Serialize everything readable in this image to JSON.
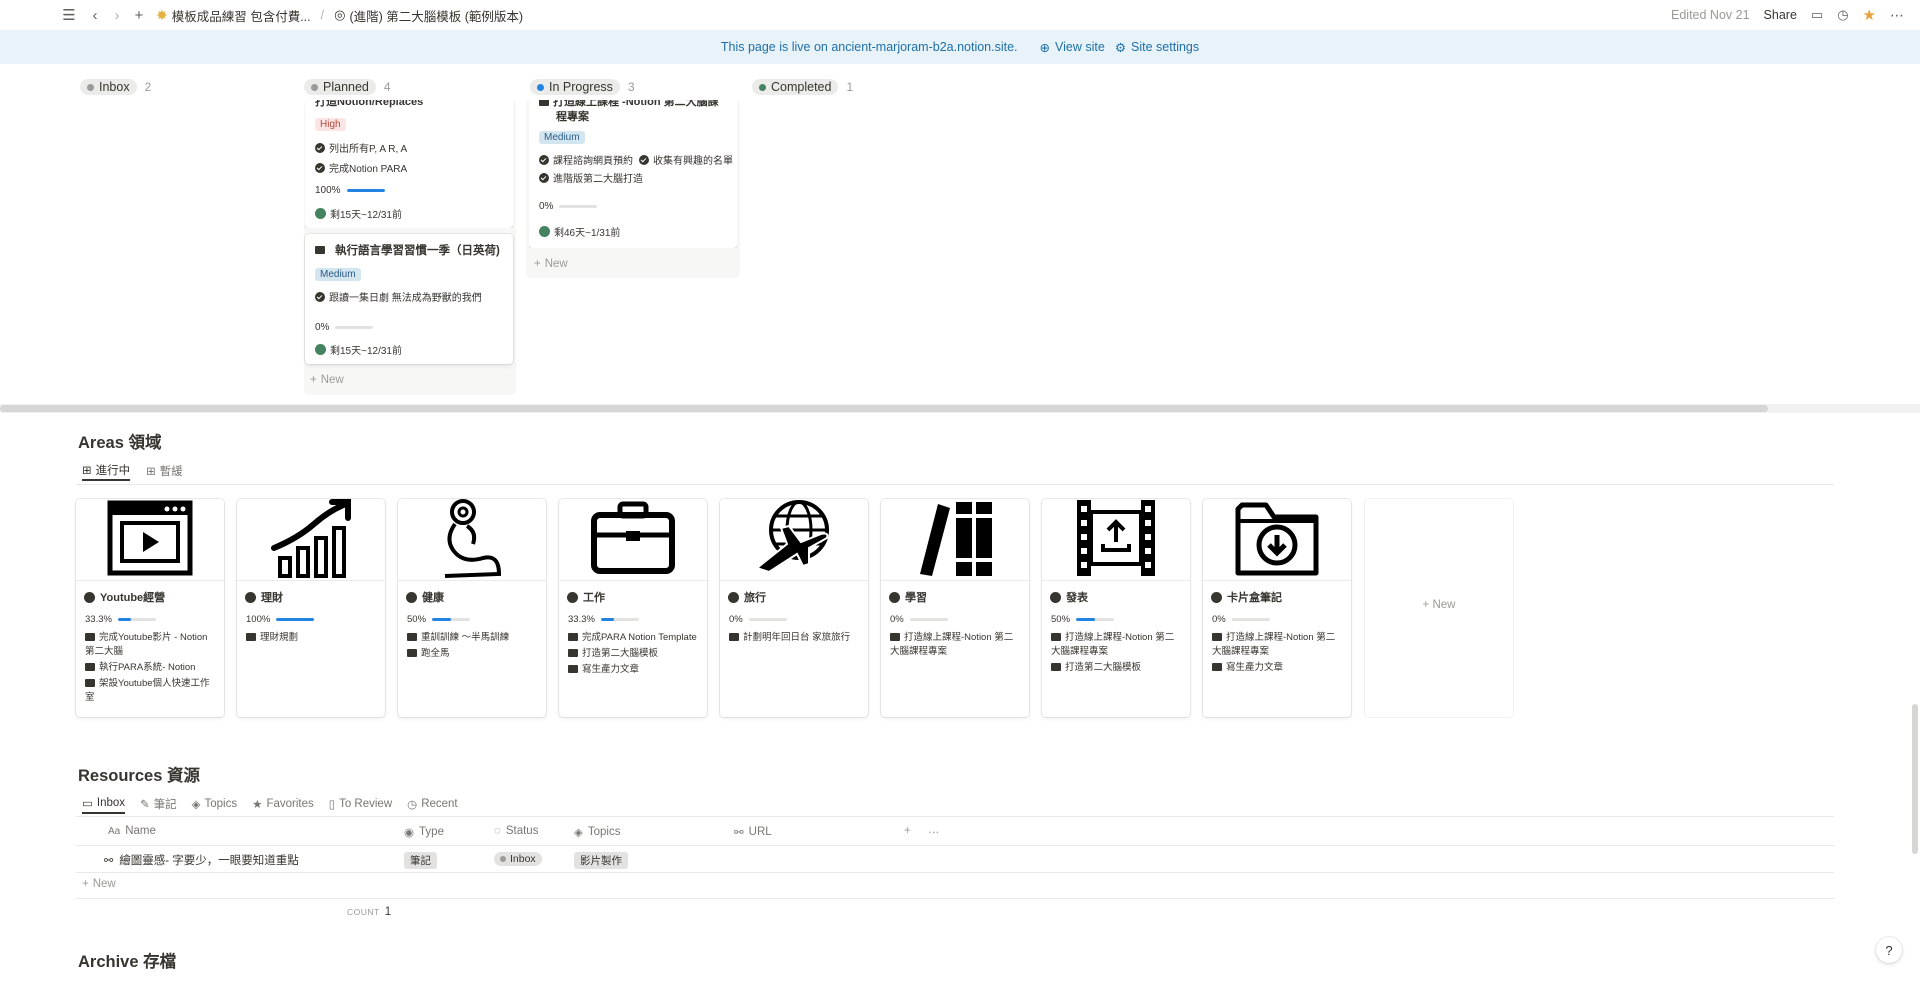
{
  "topbar": {
    "crumb1": "模板成品練習 包含付費...",
    "crumb2": "(進階) 第二大腦模板 (範例版本)",
    "edited": "Edited Nov 21",
    "share": "Share"
  },
  "banner": {
    "text": "This page is live on ancient-marjoram-b2a.notion.site.",
    "view_site": "View site",
    "site_settings": "Site settings"
  },
  "board": {
    "columns": [
      {
        "label": "Inbox",
        "count": "2",
        "color": "#9b9a97"
      },
      {
        "label": "Planned",
        "count": "4",
        "color": "#9b9a97"
      },
      {
        "label": "In Progress",
        "count": "3",
        "color": "#2383e2"
      },
      {
        "label": "Completed",
        "count": "1",
        "color": "#448361"
      }
    ],
    "planned_card1": {
      "title_partial": "打造Notion/Replaces",
      "priority": "High",
      "tasks": [
        "列出所有P, A R, A",
        "完成Notion PARA"
      ],
      "progress": "100%",
      "progress_value": 1.0,
      "due": "剩15天~12/31前"
    },
    "planned_card2": {
      "title": "執行語言學習習慣一季（日英荷)",
      "priority": "Medium",
      "tasks": [
        "跟讀一集日劇 無法成為野獸的我們"
      ],
      "progress": "0%",
      "progress_value": 0,
      "due": "剩15天~12/31前"
    },
    "inprogress_card1": {
      "title_partial": "打造線上課程 -Notion 第二大腦課",
      "title_line2": "程專案",
      "priority": "Medium",
      "tasks": [
        "課程諮詢網頁預約",
        "收集有興趣的名單",
        "進階版第二大腦打造"
      ],
      "progress": "0%",
      "progress_value": 0,
      "due": "剩46天~1/31前"
    },
    "new_label": "New"
  },
  "areas": {
    "heading": "Areas 領域",
    "tabs": [
      "進行中",
      "暫緩"
    ],
    "cards": [
      {
        "title": "Youtube經營",
        "progress": "33.3%",
        "value": 0.333,
        "icon": "play-window-icon",
        "items": [
          "完成Youtube影片 - Notion第二大腦",
          "執行PARA系統- Notion",
          "架設Youtube個人快速工作室"
        ]
      },
      {
        "title": "理財",
        "progress": "100%",
        "value": 1.0,
        "icon": "growth-chart-icon",
        "items": [
          "理財規劃"
        ]
      },
      {
        "title": "健康",
        "progress": "50%",
        "value": 0.5,
        "icon": "muscle-icon",
        "items": [
          "重訓訓練 ～半馬訓練",
          "跑全馬"
        ]
      },
      {
        "title": "工作",
        "progress": "33.3%",
        "value": 0.333,
        "icon": "briefcase-icon",
        "items": [
          "完成PARA Notion Template",
          "打造第二大腦模板",
          "寫生產力文章"
        ]
      },
      {
        "title": "旅行",
        "progress": "0%",
        "value": 0,
        "icon": "plane-globe-icon",
        "items": [
          "計劃明年回日台 家旅旅行"
        ]
      },
      {
        "title": "學習",
        "progress": "0%",
        "value": 0,
        "icon": "books-icon",
        "items": [
          "打造線上課程-Notion 第二大腦課程專案"
        ]
      },
      {
        "title": "發表",
        "progress": "50%",
        "value": 0.5,
        "icon": "film-upload-icon",
        "items": [
          "打造線上課程-Notion 第二大腦課程專案",
          "打造第二大腦模板"
        ]
      },
      {
        "title": "卡片盒筆記",
        "progress": "0%",
        "value": 0,
        "icon": "folder-download-icon",
        "items": [
          "打造線上課程-Notion 第二大腦課程專案",
          "寫生產力文章"
        ]
      }
    ],
    "new_label": "New"
  },
  "resources": {
    "heading": "Resources 資源",
    "tabs": [
      "Inbox",
      "筆記",
      "Topics",
      "Favorites",
      "To Review",
      "Recent"
    ],
    "columns": [
      "Name",
      "Type",
      "Status",
      "Topics",
      "URL"
    ],
    "rows": [
      {
        "name": "繪圖靈感- 字要少，一眼要知道重點",
        "type": "筆記",
        "status": "Inbox",
        "topics": "影片製作"
      }
    ],
    "new_label": "New",
    "count_label": "COUNT",
    "count_value": "1"
  },
  "archive": {
    "heading": "Archive 存檔"
  },
  "help": "?"
}
